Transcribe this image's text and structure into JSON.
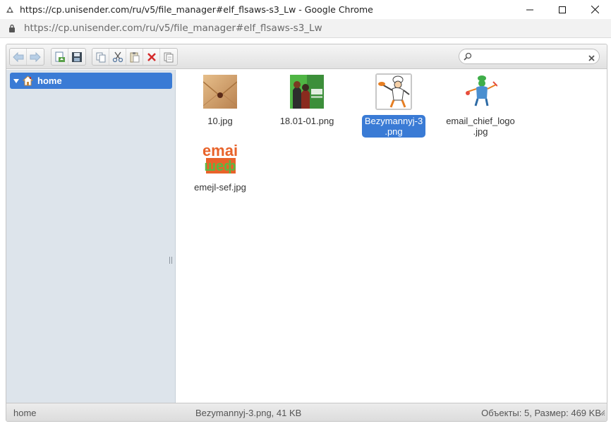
{
  "window": {
    "title": "https://cp.unisender.com/ru/v5/file_manager#elf_flsaws-s3_Lw - Google Chrome",
    "url": "https://cp.unisender.com/ru/v5/file_manager#elf_flsaws-s3_Lw",
    "icons": [
      "chrome-app-icon",
      "minimize-icon",
      "maximize-icon",
      "close-icon",
      "lock-icon"
    ]
  },
  "toolbar": {
    "buttons": [
      "back",
      "forward",
      "upload",
      "save",
      "copy",
      "cut",
      "paste",
      "delete",
      "duplicate"
    ],
    "search": {
      "value": "",
      "placeholder": ""
    }
  },
  "tree": {
    "items": [
      {
        "label": "home",
        "selected": true,
        "expanded": true
      }
    ]
  },
  "files": [
    {
      "name": "10.jpg",
      "thumb": "envelope-photo",
      "selected": false
    },
    {
      "name": "18.01-01.png",
      "thumb": "green-poster",
      "selected": false
    },
    {
      "name": "Bezymannyj-3.png",
      "display": "Bezymannyj-3\n.png",
      "thumb": "chef-cartoon",
      "selected": true
    },
    {
      "name": "email_chief_logo.jpg",
      "display": "email_chief_logo\n.jpg",
      "thumb": "chef-logo",
      "selected": false
    },
    {
      "name": "emejl-sef.jpg",
      "thumb": "email-logo-text",
      "selected": false
    }
  ],
  "status": {
    "path": "home",
    "selection": "Bezymannyj-3.png, 41 KB",
    "summary": "Объекты: 5, Размер: 469 KB"
  },
  "colors": {
    "selection": "#3a7bd5",
    "nav_bg": "#dde4eb"
  }
}
